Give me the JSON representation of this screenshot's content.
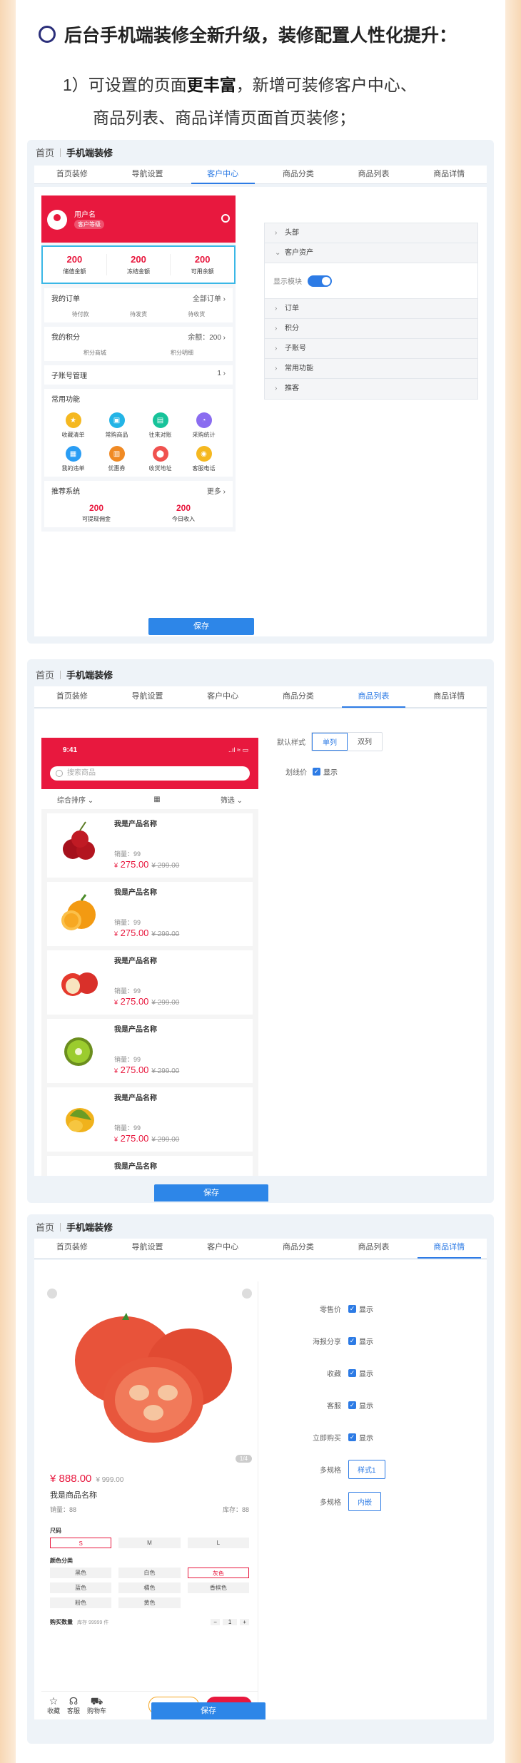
{
  "headline": "后台手机端装修全新升级，装修配置人性化提升：",
  "desc": {
    "line1_prefix": "1）可设置的页面",
    "line1_bold": "更丰富",
    "line1_suffix": "，新增可装修客户中心、",
    "line2": "商品列表、商品详情页面首页装修；"
  },
  "breadcrumb": {
    "home": "首页",
    "current": "手机端装修"
  },
  "tabs": [
    "首页装修",
    "导航设置",
    "客户中心",
    "商品分类",
    "商品列表",
    "商品详情"
  ],
  "save_label": "保存",
  "panel1": {
    "user": {
      "name": "用户名",
      "level": "客户等级"
    },
    "stats": [
      {
        "value": "200",
        "label": "储值金额"
      },
      {
        "value": "200",
        "label": "冻结金额"
      },
      {
        "value": "200",
        "label": "可用余额"
      }
    ],
    "orders": {
      "title": "我的订单",
      "all": "全部订单",
      "items": [
        "待付款",
        "待发货",
        "待收货"
      ]
    },
    "points": {
      "title": "我的积分",
      "balance": "余额：200",
      "items": [
        "积分商城",
        "积分明细"
      ]
    },
    "subaccount": {
      "title": "子账号管理",
      "count": "1"
    },
    "functions": {
      "title": "常用功能",
      "items": [
        {
          "label": "收藏清单",
          "color": "#f5b820"
        },
        {
          "label": "常购商品",
          "color": "#23b4e6"
        },
        {
          "label": "往来对账",
          "color": "#17c39a"
        },
        {
          "label": "采购统计",
          "color": "#8a6cf0"
        },
        {
          "label": "我的违单",
          "color": "#2a9df4"
        },
        {
          "label": "优惠券",
          "color": "#f08a24"
        },
        {
          "label": "收货地址",
          "color": "#f0524f"
        },
        {
          "label": "客服电话",
          "color": "#f5b820"
        }
      ]
    },
    "recommend": {
      "title": "推荐系统",
      "more": "更多",
      "stats": [
        {
          "value": "200",
          "label": "可提现佣金"
        },
        {
          "value": "200",
          "label": "今日收入"
        }
      ]
    },
    "config": {
      "rows_before": [
        "头部"
      ],
      "open_row": "客户资产",
      "toggle_label": "显示模块",
      "rows_after": [
        "订单",
        "积分",
        "子账号",
        "常用功能",
        "推客"
      ]
    }
  },
  "panel2": {
    "status": {
      "time": "9:41",
      "signal": "..ıl ≈ ▭"
    },
    "search_placeholder": "搜索商品",
    "sort": {
      "left": "综合排序",
      "right": "筛选"
    },
    "product": {
      "name": "我是产品名称",
      "sales": "销量：99",
      "currency": "¥",
      "price": "275.00",
      "old_price": "¥ 299.00"
    },
    "product_images": [
      "cherry",
      "orange",
      "apple",
      "kiwi",
      "mango",
      "blank"
    ],
    "options": {
      "default_style_label": "默认样式",
      "styles": [
        "单列",
        "双列"
      ],
      "selected_style": "单列",
      "strike_label": "划线价",
      "show_label": "显示"
    }
  },
  "panel3": {
    "price": "¥ 888.00",
    "old_price": "¥ 999.00",
    "name": "我是商品名称",
    "sales": "销量：88",
    "stock": "库存：88",
    "counter": "1/4",
    "size_title": "尺码",
    "sizes": [
      "S",
      "M",
      "L"
    ],
    "color_title": "颜色分类",
    "colors": [
      "黑色",
      "白色",
      "灰色",
      "蓝色",
      "橘色",
      "香槟色",
      "粉色",
      "黄色"
    ],
    "qty_label": "购买数量",
    "qty_stock": "库存 99999 件",
    "qty": "1",
    "bottom": {
      "fav": "收藏",
      "service": "客服",
      "cart": "购物车",
      "add_cart": "加入购物车",
      "buy": "立即购买"
    },
    "config": {
      "show": "显示",
      "items": [
        "零售价",
        "海报分享",
        "收藏",
        "客服",
        "立即购买"
      ],
      "spec_label": "多规格",
      "spec_style": "样式1",
      "spec2_label": "多规格",
      "spec2_style": "内嵌"
    }
  }
}
